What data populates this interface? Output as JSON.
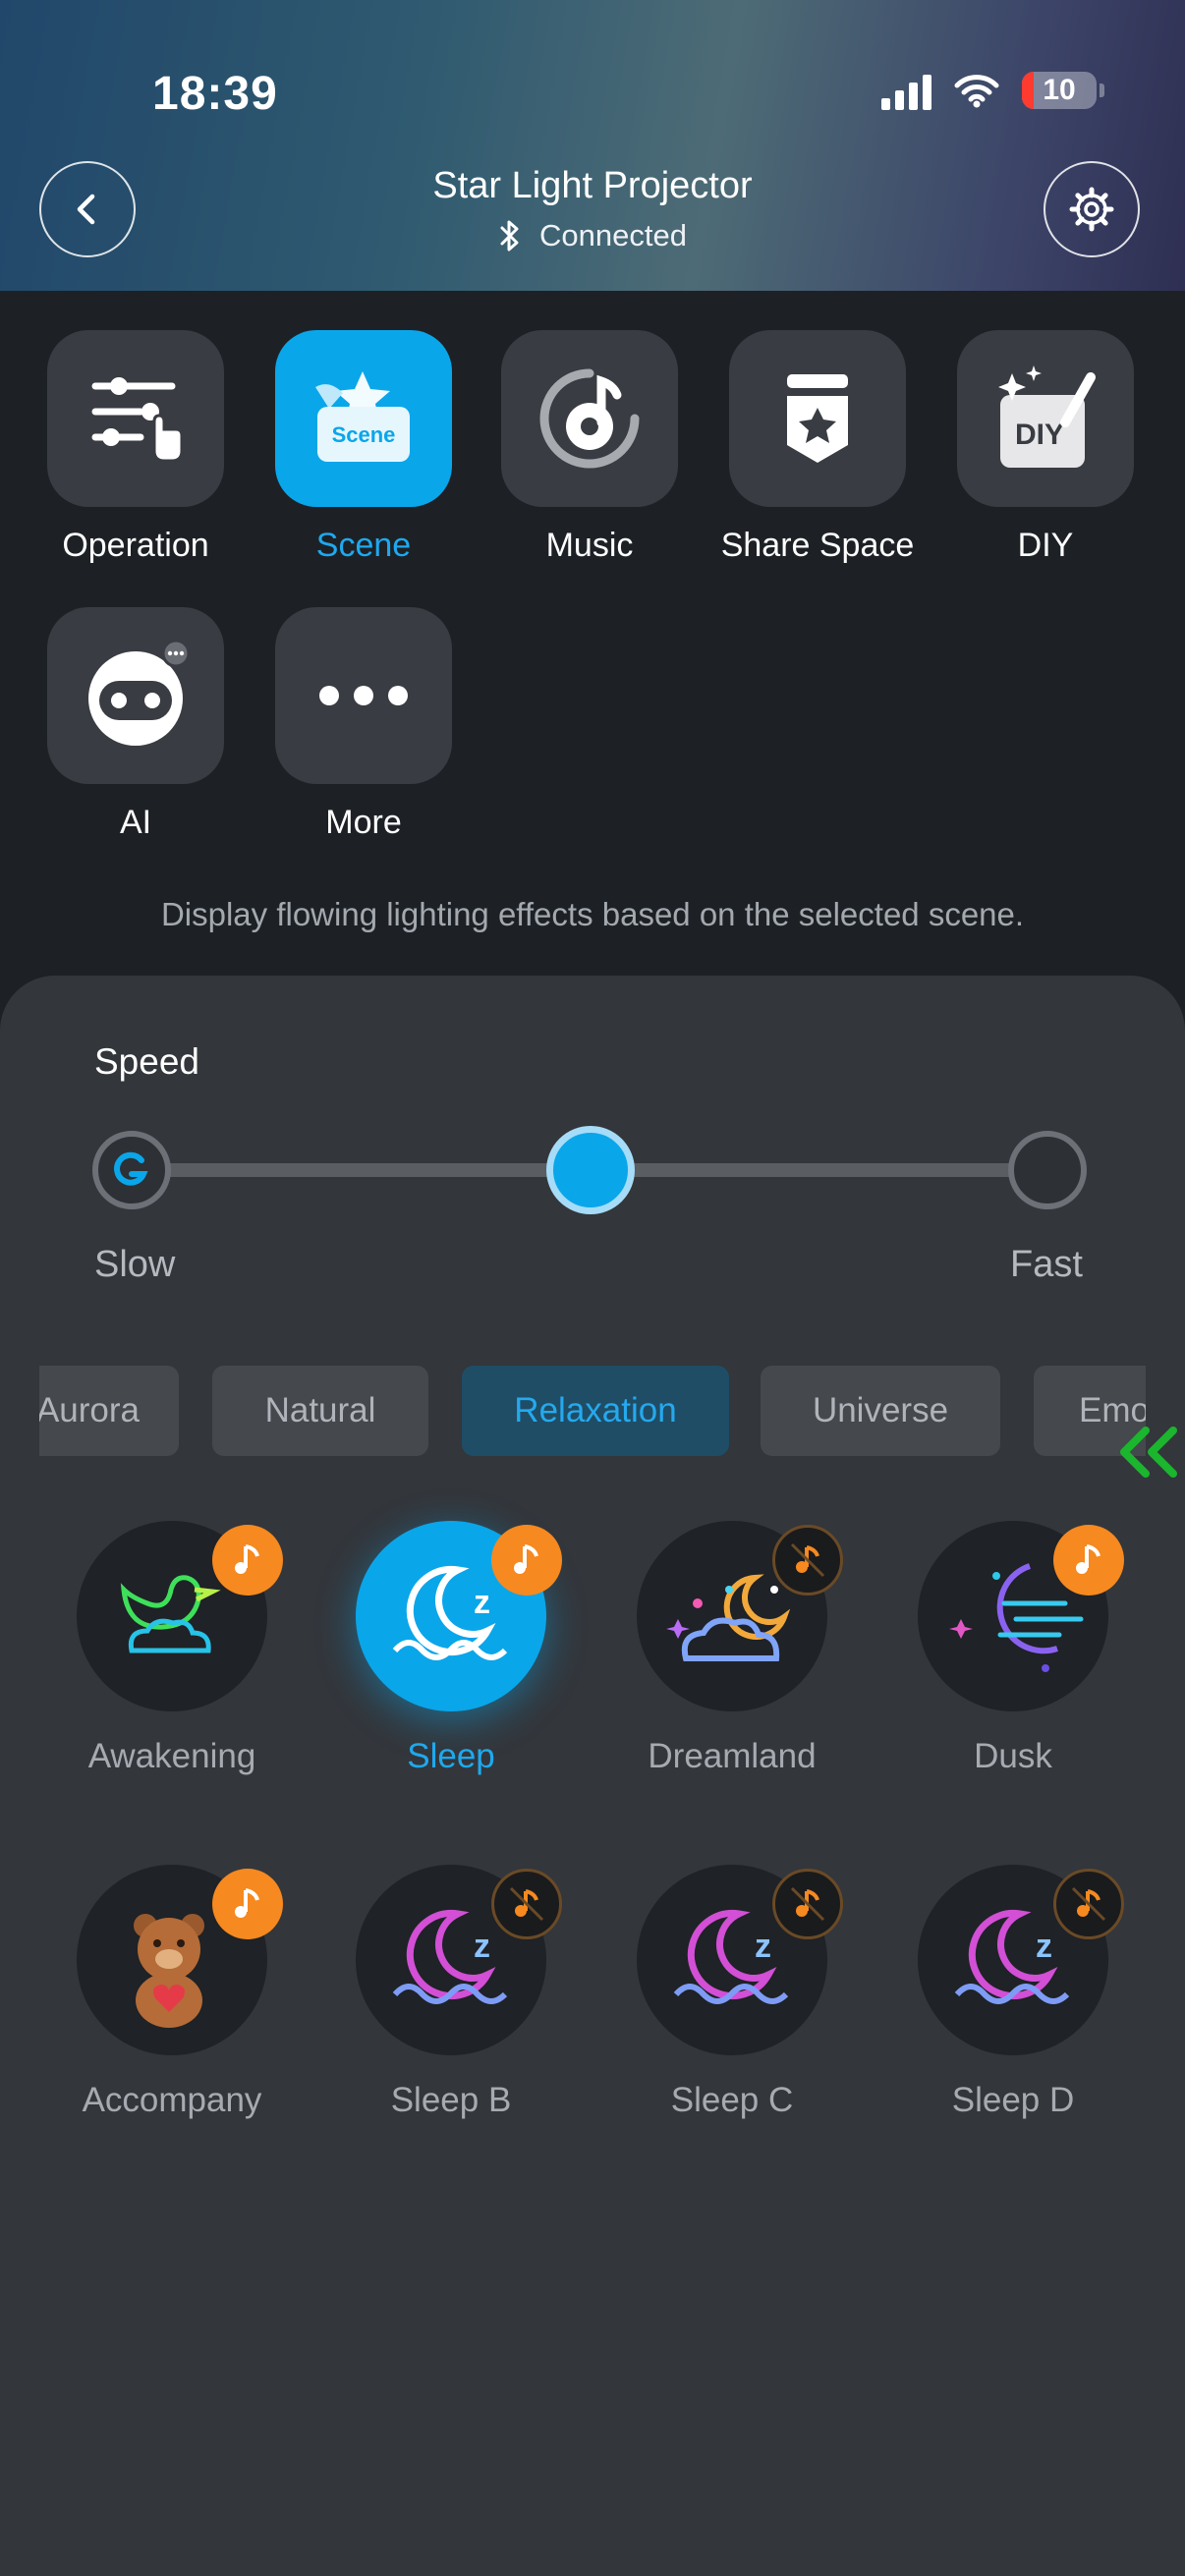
{
  "status_bar": {
    "time": "18:39",
    "battery": "10"
  },
  "header": {
    "title": "Star Light Projector",
    "subtitle": "Connected"
  },
  "tabs": [
    {
      "label": "Operation"
    },
    {
      "label": "Scene",
      "active": true
    },
    {
      "label": "Music"
    },
    {
      "label": "Share Space"
    },
    {
      "label": "DIY",
      "icon_text": "DIY"
    },
    {
      "label": "AI"
    },
    {
      "label": "More"
    }
  ],
  "scene_icon_text": "Scene",
  "description": "Display flowing lighting effects based on the selected scene.",
  "speed": {
    "label": "Speed",
    "min_label": "Slow",
    "max_label": "Fast",
    "value_fraction": 0.5
  },
  "categories": [
    "Aurora",
    "Natural",
    "Relaxation",
    "Universe",
    "Emo"
  ],
  "selected_category": "Relaxation",
  "scenes": [
    {
      "label": "Awakening",
      "music": true
    },
    {
      "label": "Sleep",
      "music": true,
      "selected": true
    },
    {
      "label": "Dreamland",
      "music": false
    },
    {
      "label": "Dusk",
      "music": true
    },
    {
      "label": "Accompany",
      "music": true
    },
    {
      "label": "Sleep B",
      "music": false
    },
    {
      "label": "Sleep C",
      "music": false
    },
    {
      "label": "Sleep D",
      "music": false
    }
  ],
  "colors": {
    "accent": "#0aa6ea",
    "music_badge": "#f6891f",
    "background": "#1d2126",
    "panel": "#33363b"
  }
}
